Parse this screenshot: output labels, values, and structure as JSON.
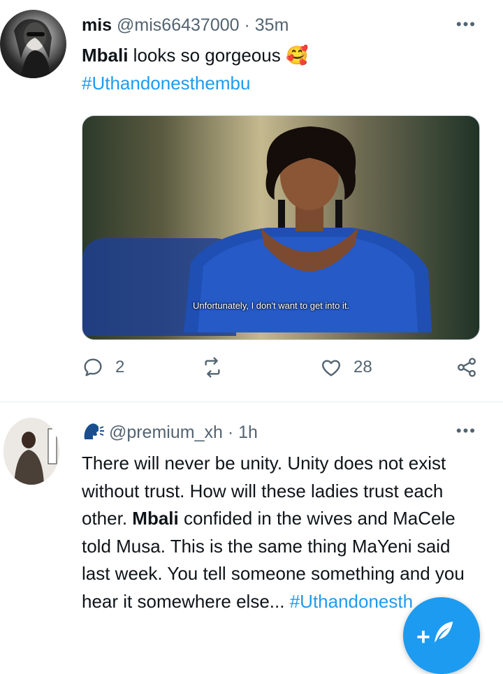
{
  "tweet1": {
    "name": "mis",
    "handle": "@mis66437000",
    "sep": "·",
    "time": "35m",
    "text_bold": "Mbali",
    "text_rest": " looks so gorgeous",
    "emoji": "🥰",
    "hashtag": "#Uthandonesthembu",
    "media_caption": "Unfortunately, I don't want to get into it.",
    "reply_count": "2",
    "like_count": "28"
  },
  "tweet2": {
    "handle": "@premium_xh",
    "sep": "·",
    "time": "1h",
    "text_part1": "There will never be unity. Unity does not exist without trust. How will these ladies trust each other. ",
    "text_bold": "Mbali",
    "text_part2": " confided in the wives and MaCele told Musa. This is the same thing MaYeni said last week. You tell someone something and you hear it somewhere else... ",
    "hashtag": "#Uthandonesth"
  },
  "more_glyph": "•••",
  "fab": {
    "plus": "+"
  },
  "colors": {
    "accent": "#1d9bf0",
    "muted": "#536471",
    "text": "#0f1419"
  }
}
